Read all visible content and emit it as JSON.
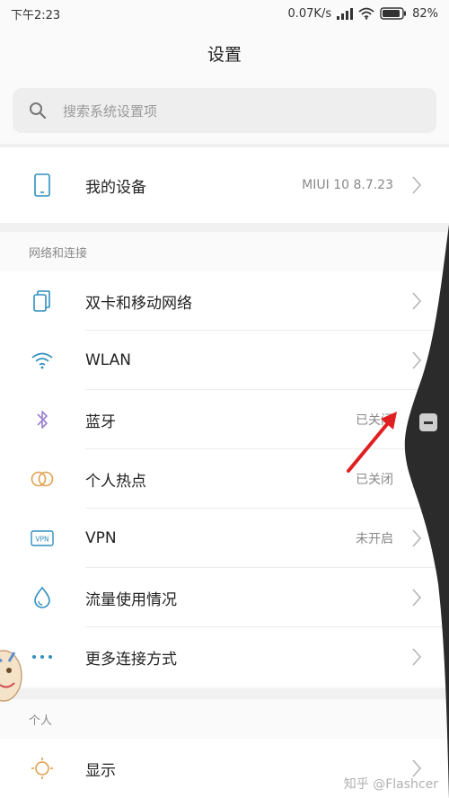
{
  "status_bar": {
    "time": "下午2:23",
    "network_speed": "0.07K/s",
    "battery": "82%"
  },
  "header": {
    "title": "设置"
  },
  "search": {
    "placeholder": "搜索系统设置项"
  },
  "device": {
    "label": "我的设备",
    "value": "MIUI 10 8.7.23",
    "icon": "phone-icon"
  },
  "sections": [
    {
      "title": "网络和连接",
      "items": [
        {
          "label": "双卡和移动网络",
          "value": "",
          "icon": "dual-sim-icon"
        },
        {
          "label": "WLAN",
          "value": "",
          "icon": "wifi-icon"
        },
        {
          "label": "蓝牙",
          "value": "已关闭",
          "icon": "bluetooth-icon"
        },
        {
          "label": "个人热点",
          "value": "已关闭",
          "icon": "hotspot-icon"
        },
        {
          "label": "VPN",
          "value": "未开启",
          "icon": "vpn-icon",
          "icon_text": "VPN"
        },
        {
          "label": "流量使用情况",
          "value": "",
          "icon": "data-usage-icon"
        },
        {
          "label": "更多连接方式",
          "value": "",
          "icon": "more-icon"
        }
      ]
    },
    {
      "title": "个人",
      "items": [
        {
          "label": "显示",
          "value": "",
          "icon": "display-icon"
        }
      ]
    }
  ],
  "watermark": "知乎 @Flashcer",
  "colors": {
    "icon_blue": "#2f8fbf",
    "arrow_red": "#e02020",
    "side_panel": "#2b2b2b"
  }
}
